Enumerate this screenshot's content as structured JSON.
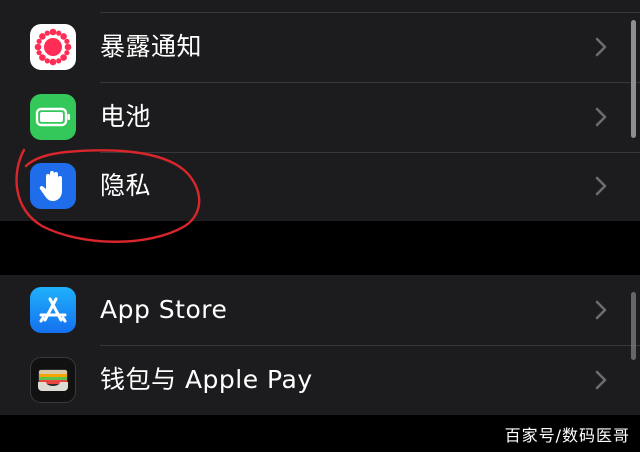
{
  "settings": {
    "group1": [
      {
        "label": "暴露通知",
        "icon": "exposure-notification-icon",
        "color": "#ffffff"
      },
      {
        "label": "电池",
        "icon": "battery-icon",
        "color": "#34c759"
      },
      {
        "label": "隐私",
        "icon": "privacy-hand-icon",
        "color": "#1f6dea"
      }
    ],
    "group2": [
      {
        "label": "App Store",
        "icon": "app-store-icon",
        "color": "#1d8cf8"
      },
      {
        "label": "钱包与 Apple Pay",
        "icon": "wallet-icon",
        "color": "#1c1c1e"
      }
    ]
  },
  "watermark": "百家号/数码医哥",
  "annotation": {
    "color": "#d8262c",
    "target": "隐私"
  }
}
